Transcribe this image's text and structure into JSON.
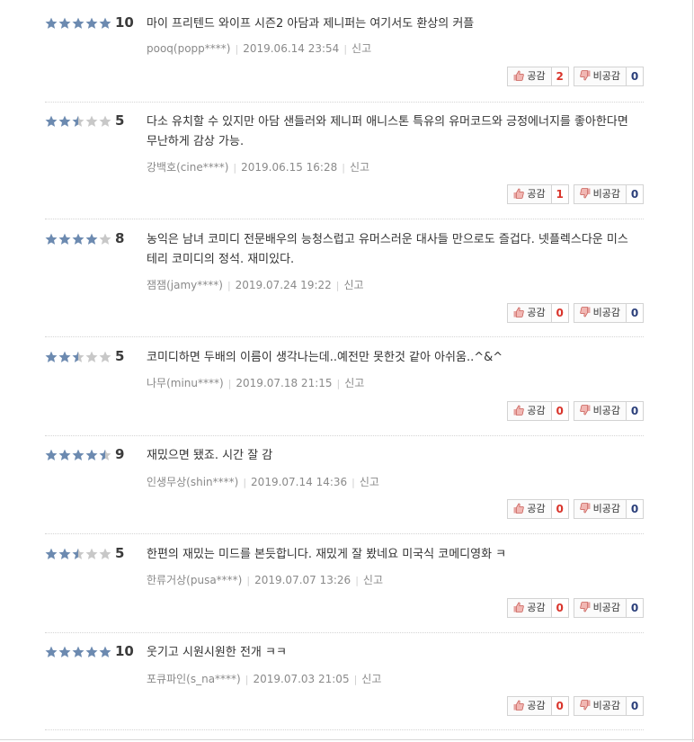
{
  "labels": {
    "like": "공감",
    "dislike": "비공감",
    "report": "신고"
  },
  "colors": {
    "star_on": "#6c8ab0",
    "star_off": "#c8c8c8",
    "like_count": "#d9342b",
    "dislike_count": "#2b3f7a"
  },
  "reviews": [
    {
      "rating": 10,
      "score": "10",
      "text": "마이 프리텐드 와이프 시즌2 아담과 제니퍼는 여기서도 환상의 커플",
      "author": "pooq(popp****)",
      "date": "2019.06.14 23:54",
      "like": "2",
      "dislike": "0"
    },
    {
      "rating": 5,
      "score": "5",
      "text": "다소 유치할 수 있지만 아담 샌들러와 제니퍼 애니스톤 특유의 유머코드와 긍정에너지를 좋아한다면 무난하게 감상 가능.",
      "author": "강백호(cine****)",
      "date": "2019.06.15 16:28",
      "like": "1",
      "dislike": "0"
    },
    {
      "rating": 8,
      "score": "8",
      "text": "농익은 남녀 코미디 전문배우의 능청스럽고 유머스러운 대사들 만으로도 즐겁다. 넷플렉스다운 미스테리 코미디의 정석. 재미있다.",
      "author": "잼잼(jamy****)",
      "date": "2019.07.24 19:22",
      "like": "0",
      "dislike": "0"
    },
    {
      "rating": 5,
      "score": "5",
      "text": "코미디하면 두배의 이름이 생각나는데..예전만 못한것 같아 아쉬움..^&^",
      "author": "나무(minu****)",
      "date": "2019.07.18 21:15",
      "like": "0",
      "dislike": "0"
    },
    {
      "rating": 9,
      "score": "9",
      "text": "재밌으면 됐죠. 시간 잘 감",
      "author": "인생무상(shin****)",
      "date": "2019.07.14 14:36",
      "like": "0",
      "dislike": "0"
    },
    {
      "rating": 5,
      "score": "5",
      "text": "한편의 재밌는 미드를 본듯합니다. 재밌게 잘 봤네요 미국식 코메디영화 ㅋ",
      "author": "한류거상(pusa****)",
      "date": "2019.07.07 13:26",
      "like": "0",
      "dislike": "0"
    },
    {
      "rating": 10,
      "score": "10",
      "text": "웃기고 시원시원한 전개 ㅋㅋ",
      "author": "포큐파인(s_na****)",
      "date": "2019.07.03 21:05",
      "like": "0",
      "dislike": "0"
    }
  ]
}
